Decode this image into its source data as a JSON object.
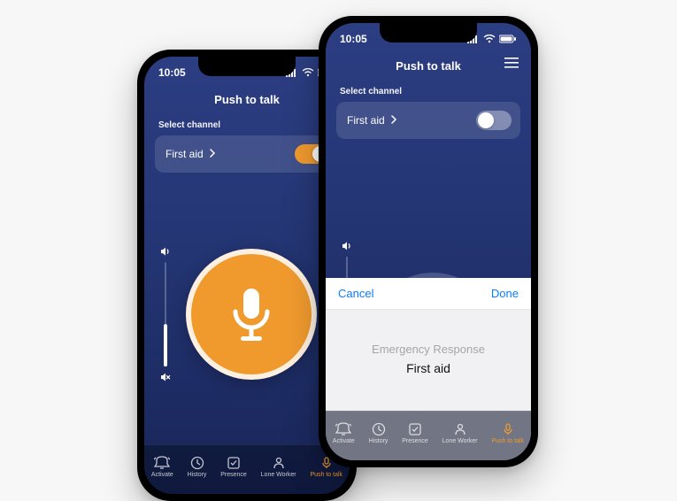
{
  "statusbar": {
    "time": "10:05"
  },
  "header": {
    "title": "Push to talk"
  },
  "section": {
    "label": "Select channel"
  },
  "channel": {
    "name": "First aid"
  },
  "picker": {
    "cancel": "Cancel",
    "done": "Done",
    "option_above": "Emergency Response",
    "option_selected": "First aid"
  },
  "tabs": {
    "activate": "Activate",
    "history": "History",
    "presence": "Presence",
    "lone_worker": "Lone Worker",
    "push_to_talk": "Push to talk"
  },
  "colors": {
    "accent": "#f09a2e",
    "bg_top": "#2c3e82",
    "bg_bottom": "#182558",
    "link": "#0a7cff"
  }
}
